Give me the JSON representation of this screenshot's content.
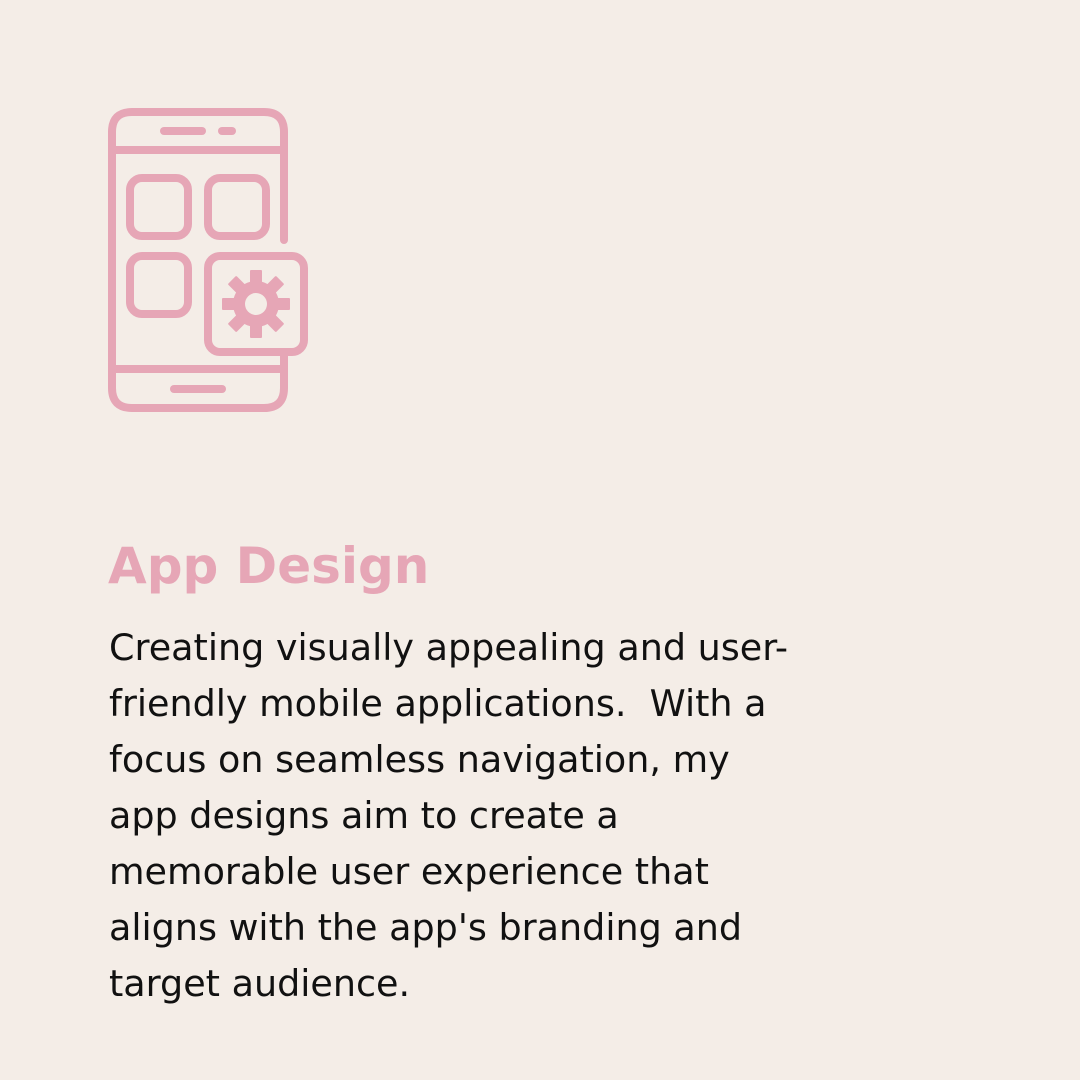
{
  "colors": {
    "background": "#f4ede7",
    "accent": "#e6a6b6",
    "text": "#111111"
  },
  "icon": {
    "name": "mobile-app-settings-icon"
  },
  "service": {
    "title": "App Design",
    "description_lines": [
      "Creating visually appealing and user-",
      "friendly mobile applications.  With a",
      "focus on seamless navigation, my",
      "app designs aim to create a",
      "memorable user experience that",
      "aligns with the app's branding and",
      "target audience."
    ]
  }
}
